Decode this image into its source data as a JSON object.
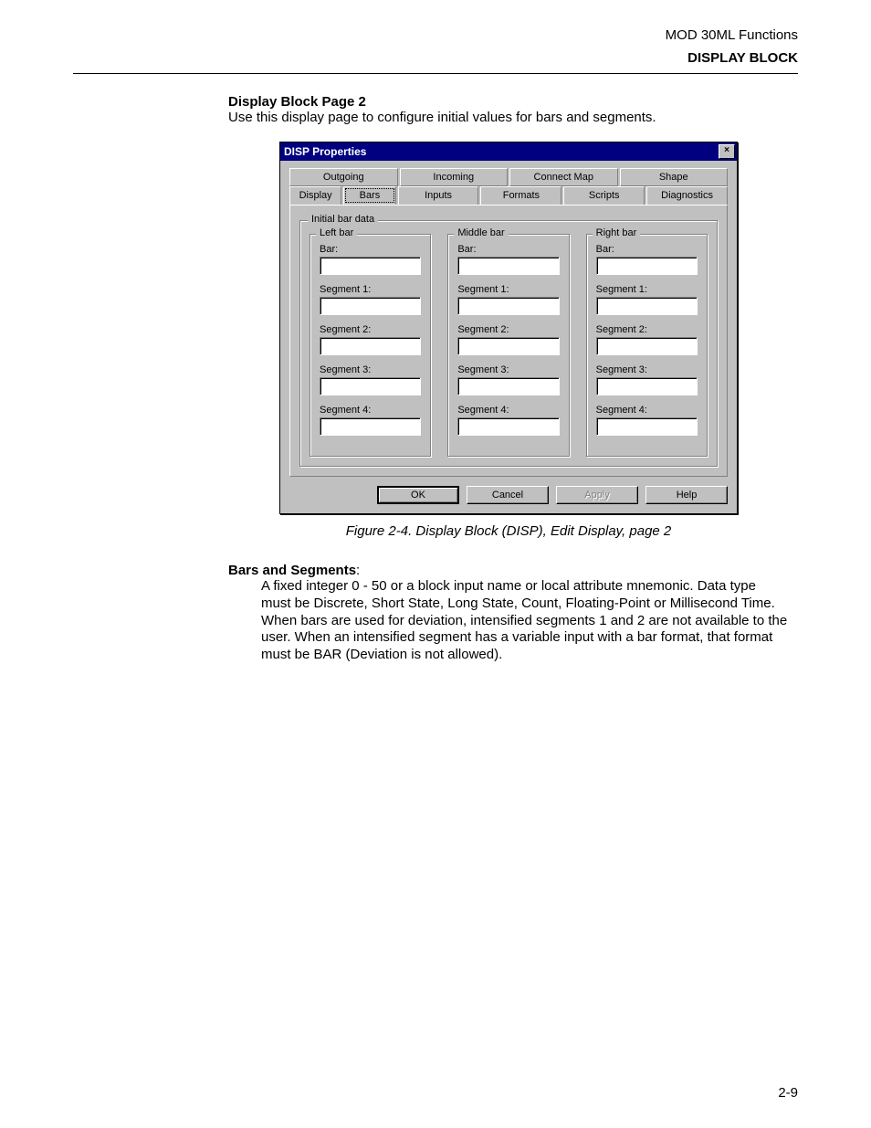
{
  "header": {
    "line1": "MOD 30ML Functions",
    "line2": "DISPLAY BLOCK"
  },
  "section": {
    "title": "Display Block Page 2",
    "desc": "Use this display page to configure initial values for bars and segments."
  },
  "dialog": {
    "title": "DISP Properties",
    "close_glyph": "×",
    "tabs_row1": [
      "Outgoing",
      "Incoming",
      "Connect Map",
      "Shape"
    ],
    "tabs_row2": [
      "Display",
      "Bars",
      "Inputs",
      "Formats",
      "Scripts",
      "Diagnostics"
    ],
    "active_tab": "Bars",
    "group_legend": "Initial bar data",
    "columns": [
      {
        "legend": "Left bar",
        "fields": [
          {
            "label": "Bar:",
            "value": ""
          },
          {
            "label": "Segment 1:",
            "value": ""
          },
          {
            "label": "Segment 2:",
            "value": ""
          },
          {
            "label": "Segment 3:",
            "value": ""
          },
          {
            "label": "Segment 4:",
            "value": ""
          }
        ]
      },
      {
        "legend": "Middle bar",
        "fields": [
          {
            "label": "Bar:",
            "value": ""
          },
          {
            "label": "Segment 1:",
            "value": ""
          },
          {
            "label": "Segment 2:",
            "value": ""
          },
          {
            "label": "Segment 3:",
            "value": ""
          },
          {
            "label": "Segment 4:",
            "value": ""
          }
        ]
      },
      {
        "legend": "Right bar",
        "fields": [
          {
            "label": "Bar:",
            "value": ""
          },
          {
            "label": "Segment 1:",
            "value": ""
          },
          {
            "label": "Segment 2:",
            "value": ""
          },
          {
            "label": "Segment 3:",
            "value": ""
          },
          {
            "label": "Segment 4:",
            "value": ""
          }
        ]
      }
    ],
    "buttons": {
      "ok": "OK",
      "cancel": "Cancel",
      "apply": "Apply",
      "help": "Help"
    }
  },
  "figure_caption": "Figure 2-4.  Display Block (DISP), Edit Display, page 2",
  "paragraph": {
    "title": "Bars and Segments",
    "colon": ":",
    "body": "A fixed integer 0 - 50 or a block input name or local attribute mnemonic. Data type must be Discrete, Short State, Long State, Count, Floating-Point or Millisecond Time. When bars are used for deviation, intensified segments 1 and 2 are not available to the user. When an intensified segment has a variable input with a bar format, that format must be BAR (Deviation is not allowed)."
  },
  "page_number": "2-9"
}
